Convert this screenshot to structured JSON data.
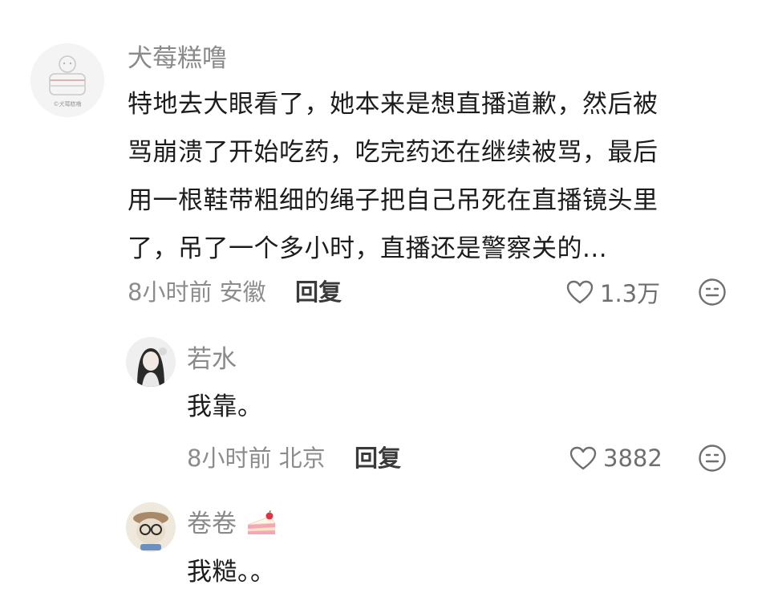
{
  "comments": [
    {
      "username": "犬莓糕噜",
      "avatar_watermark": "©犬莓糕噜",
      "text_lines": [
        "特地去大眼看了，她本来是想直播道歉，然后被",
        "骂崩溃了开始吃药，吃完药还在继续被骂，最后",
        "用一根鞋带粗细的绳子把自己吊死在直播镜头里",
        "了，吊了一个多小时，直播还是警察关的..."
      ],
      "meta": "8小时前 安徽",
      "reply_label": "回复",
      "likes": "1.3万"
    },
    {
      "username": "若水",
      "text_lines": [
        "我靠。"
      ],
      "meta": "8小时前 北京",
      "reply_label": "回复",
      "likes": "3882"
    },
    {
      "username": "卷卷",
      "username_badge_icon": "cake-emoji-icon",
      "text_lines": [
        "我糙。。"
      ]
    }
  ],
  "colors": {
    "name": "#8a8a8a",
    "text": "#1c1c1c",
    "meta": "#8c8c8c",
    "reply": "#3a3a3a"
  }
}
